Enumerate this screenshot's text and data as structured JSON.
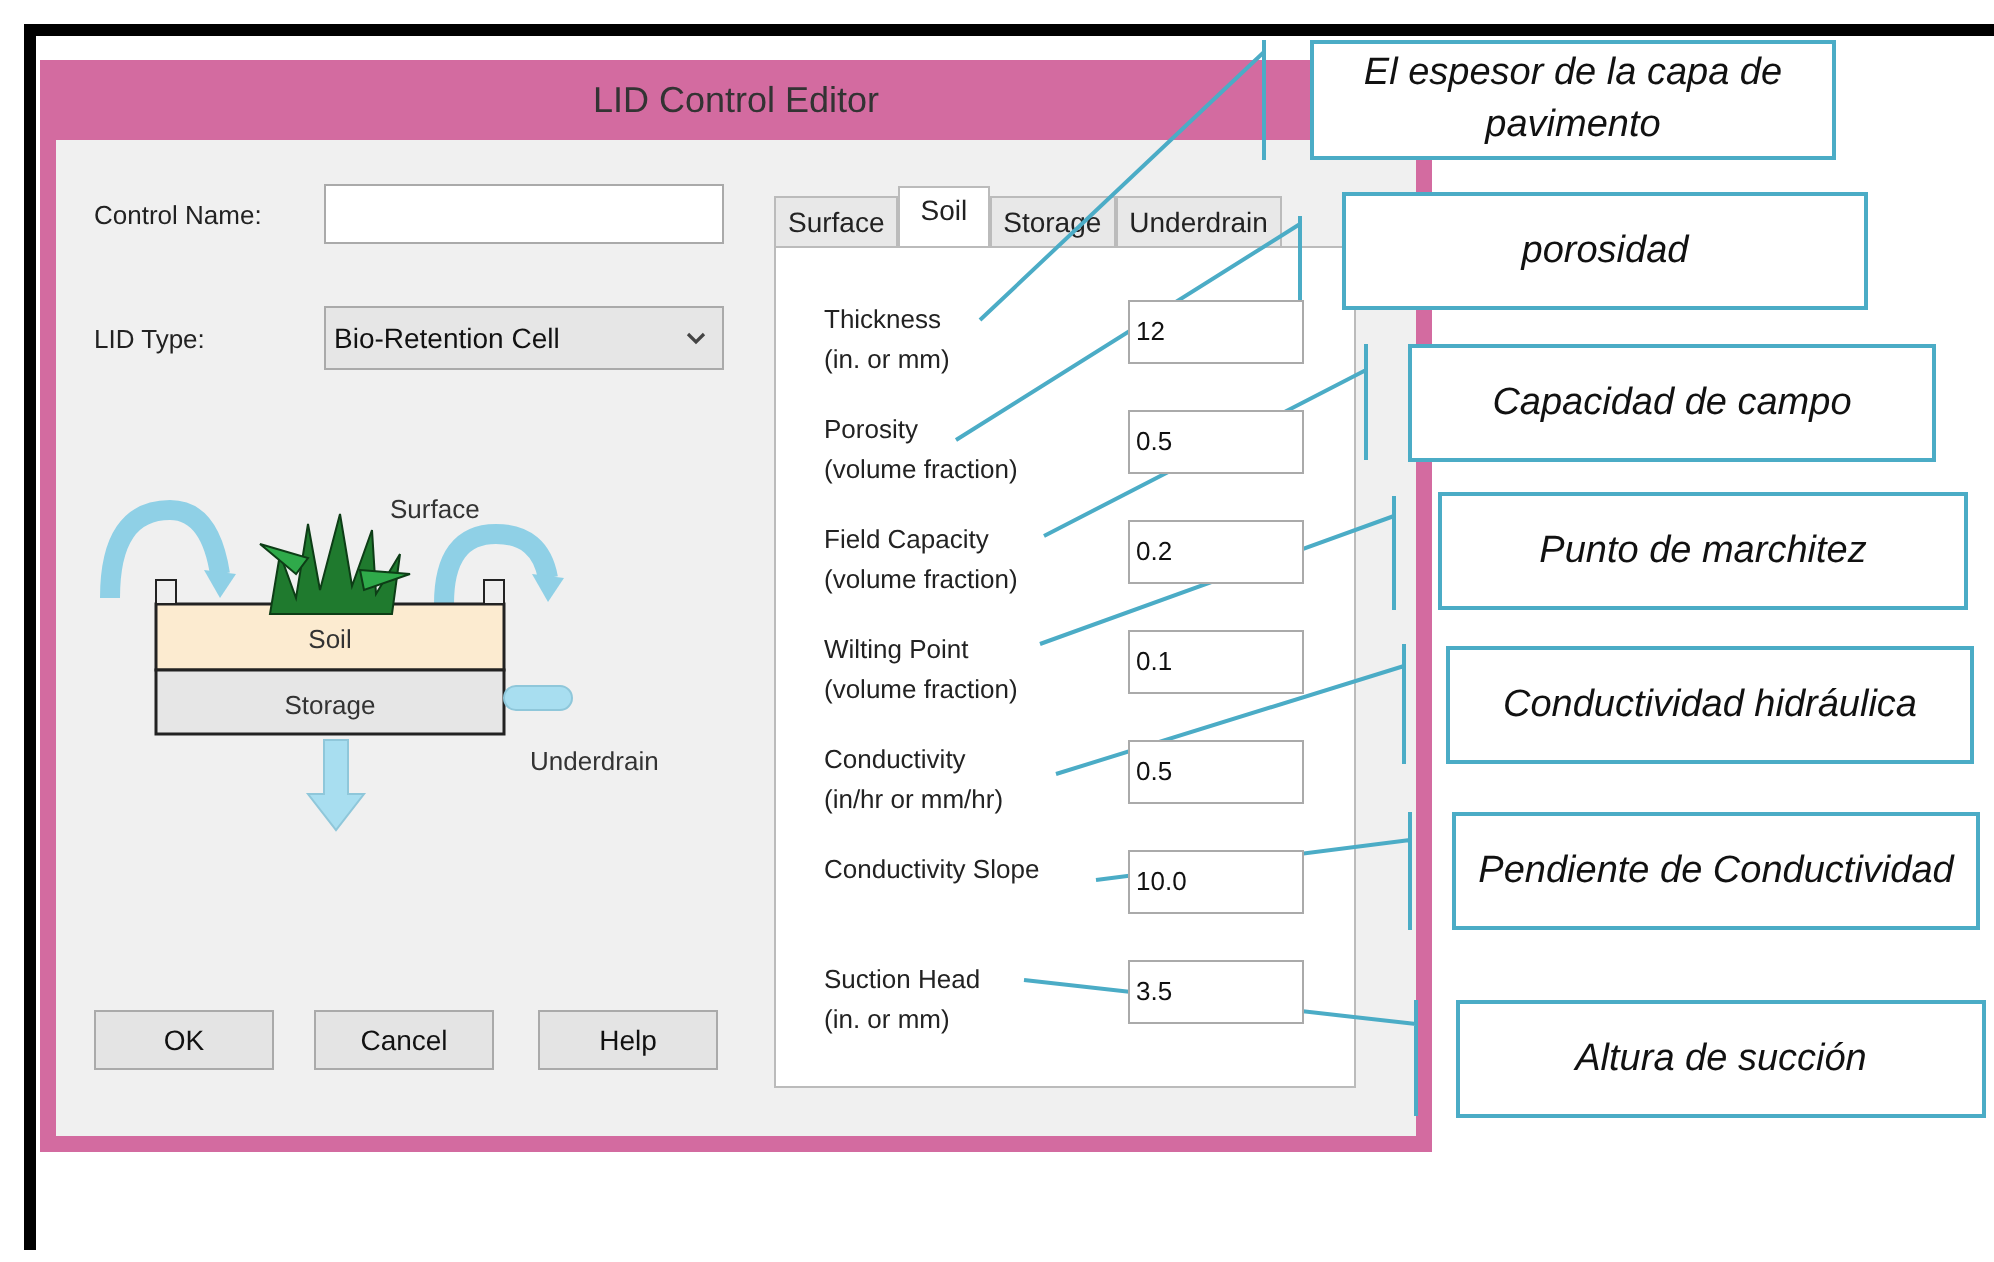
{
  "window": {
    "title": "LID Control Editor"
  },
  "control_name": {
    "label": "Control Name:"
  },
  "lid_type": {
    "label": "LID Type:",
    "value": "Bio-Retention Cell"
  },
  "diagram": {
    "surface": "Surface",
    "soil": "Soil",
    "storage": "Storage",
    "underdrain": "Underdrain"
  },
  "buttons": [
    "OK",
    "Cancel",
    "Help"
  ],
  "tabs": [
    {
      "label": "Surface",
      "selected": false
    },
    {
      "label": "Soil",
      "selected": true
    },
    {
      "label": "Storage",
      "selected": false
    },
    {
      "label": "Underdrain",
      "selected": false
    }
  ],
  "parameters": [
    {
      "label": "Thickness",
      "unit": "(in. or mm)",
      "value": "12"
    },
    {
      "label": "Porosity",
      "unit": "(volume fraction)",
      "value": "0.5"
    },
    {
      "label": "Field Capacity",
      "unit": "(volume fraction)",
      "value": "0.2"
    },
    {
      "label": "Wilting Point",
      "unit": "(volume fraction)",
      "value": "0.1"
    },
    {
      "label": "Conductivity",
      "unit": "(in/hr or mm/hr)",
      "value": "0.5"
    },
    {
      "label": "Conductivity Slope",
      "value": "10.0"
    },
    {
      "label": "Suction Head",
      "unit": "(in. or mm)",
      "value": "3.5"
    }
  ],
  "callouts": [
    "El espesor de la capa de pavimento",
    "porosidad",
    "Capacidad de campo",
    "Punto de marchitez",
    "Conductividad hidráulica",
    "Pendiente de Conductividad",
    "Altura de succión"
  ]
}
